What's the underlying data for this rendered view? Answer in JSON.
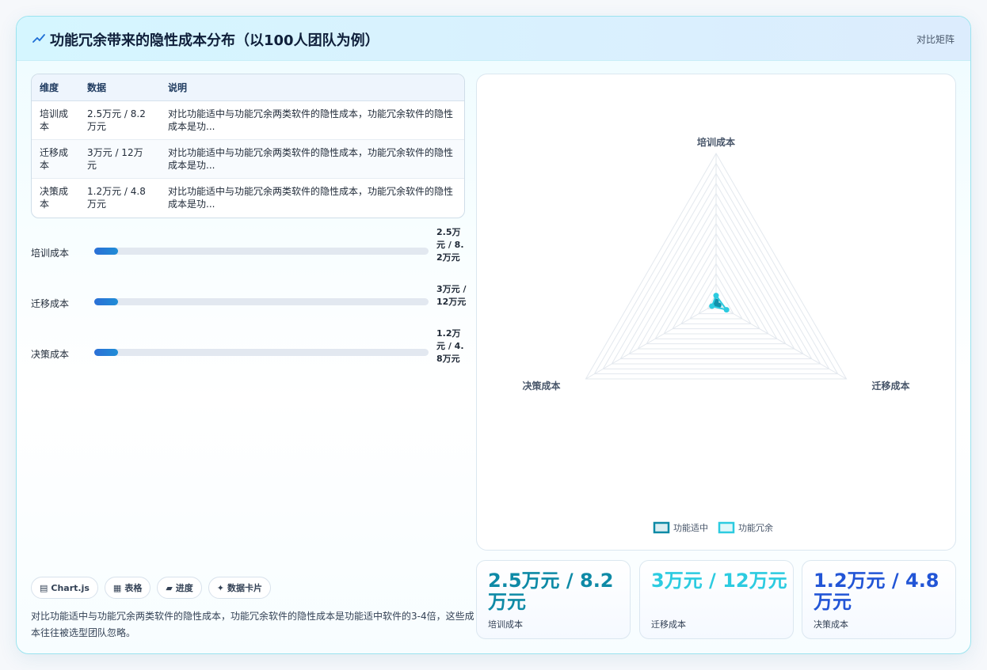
{
  "header": {
    "title": "功能冗余带来的隐性成本分布（以100人团队为例）",
    "action": "对比矩阵"
  },
  "table": {
    "headers": [
      "维度",
      "数据",
      "说明"
    ],
    "rows": [
      {
        "dim": "培训成本",
        "data": "2.5万元 / 8.2万元",
        "note": "对比功能适中与功能冗余两类软件的隐性成本，功能冗余软件的隐性成本是功..."
      },
      {
        "dim": "迁移成本",
        "data": "3万元 / 12万元",
        "note": "对比功能适中与功能冗余两类软件的隐性成本，功能冗余软件的隐性成本是功..."
      },
      {
        "dim": "决策成本",
        "data": "1.2万元 / 4.8万元",
        "note": "对比功能适中与功能冗余两类软件的隐性成本，功能冗余软件的隐性成本是功..."
      }
    ]
  },
  "progress": [
    {
      "label": "培训成本",
      "value": "2.5万元 / 8.2万元",
      "fraction": 0.07
    },
    {
      "label": "迁移成本",
      "value": "3万元 / 12万元",
      "fraction": 0.07
    },
    {
      "label": "决策成本",
      "value": "1.2万元 / 4.8万元",
      "fraction": 0.07
    }
  ],
  "chips": [
    {
      "icon": "bar-chart-icon",
      "glyph": "▤",
      "label": "Chart.js"
    },
    {
      "icon": "table-icon",
      "glyph": "▦",
      "label": "表格"
    },
    {
      "icon": "progress-icon",
      "glyph": "▰",
      "label": "进度"
    },
    {
      "icon": "sparkle-icon",
      "glyph": "✦",
      "label": "数据卡片"
    }
  ],
  "description": "对比功能适中与功能冗余两类软件的隐性成本，功能冗余软件的隐性成本是功能适中软件的3-4倍，这些成本往往被选型团队忽略。",
  "stats": [
    {
      "value": "2.5万元 / 8.2万元",
      "label": "培训成本",
      "color": "#0e8aa6"
    },
    {
      "value": "3万元 / 12万元",
      "label": "迁移成本",
      "color": "#2ccbe0"
    },
    {
      "value": "1.2万元 / 4.8万元",
      "label": "决策成本",
      "color": "#2255d6"
    }
  ],
  "colors": {
    "series_moderate": "#0e8aa6",
    "series_redundant": "#2ccbe0",
    "accent": "#2b6fd6"
  },
  "chart_data": {
    "type": "radar",
    "axes": [
      "培训成本",
      "迁移成本",
      "决策成本"
    ],
    "rmax": 150,
    "grid_levels": 15,
    "series": [
      {
        "name": "功能适中",
        "values": [
          2.5,
          3,
          1.2
        ]
      },
      {
        "name": "功能冗余",
        "values": [
          8.2,
          12,
          4.8
        ]
      }
    ],
    "legend_position": "bottom"
  }
}
